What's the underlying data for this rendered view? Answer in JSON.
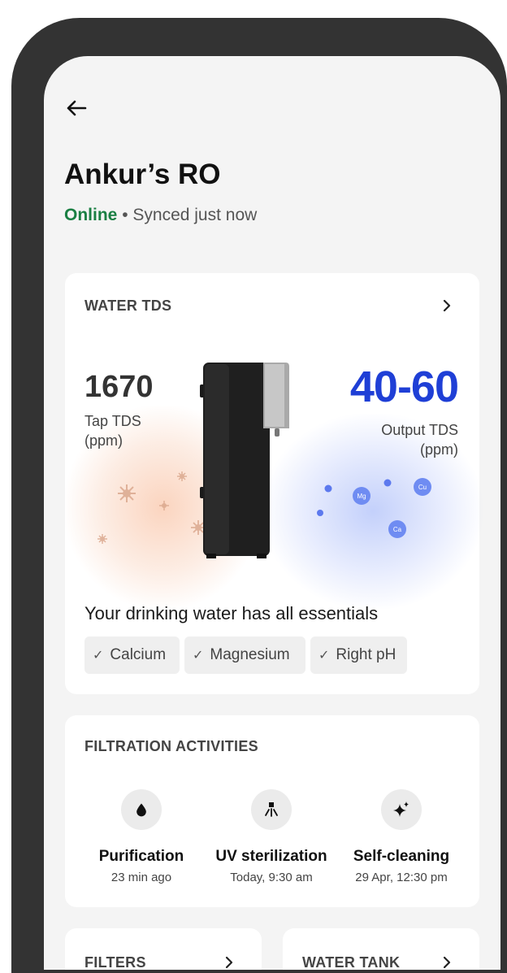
{
  "device": {
    "title": "Ankur’s RO",
    "status_online": "Online",
    "status_separator": "•",
    "status_synced": "Synced just now"
  },
  "tds_card": {
    "heading": "WATER TDS",
    "tap_value": "1670",
    "tap_label": "Tap TDS (ppm)",
    "output_value": "40-60",
    "output_label": "Output TDS (ppm)",
    "mineral_bubbles": [
      "Mg",
      "Cu",
      "Ca"
    ],
    "essentials_text": "Your drinking water has all essentials",
    "chips": [
      "Calcium",
      "Magnesium",
      "Right pH"
    ],
    "chip_tick": "✓",
    "accent_color": "#1f3fd6"
  },
  "filtration_card": {
    "heading": "FILTRATION ACTIVITIES",
    "activities": [
      {
        "name": "Purification",
        "time": "23 min ago",
        "icon": "water-drop-icon"
      },
      {
        "name": "UV sterilization",
        "time": "Today, 9:30 am",
        "icon": "uv-lamp-icon"
      },
      {
        "name": "Self-cleaning",
        "time": "29 Apr, 12:30 pm",
        "icon": "sparkle-icon"
      }
    ]
  },
  "bottom_cards": {
    "filters_label": "FILTERS",
    "water_tank_label": "WATER TANK"
  },
  "colors": {
    "online": "#1a7f43",
    "background": "#f4f4f4",
    "frame": "#333333"
  }
}
